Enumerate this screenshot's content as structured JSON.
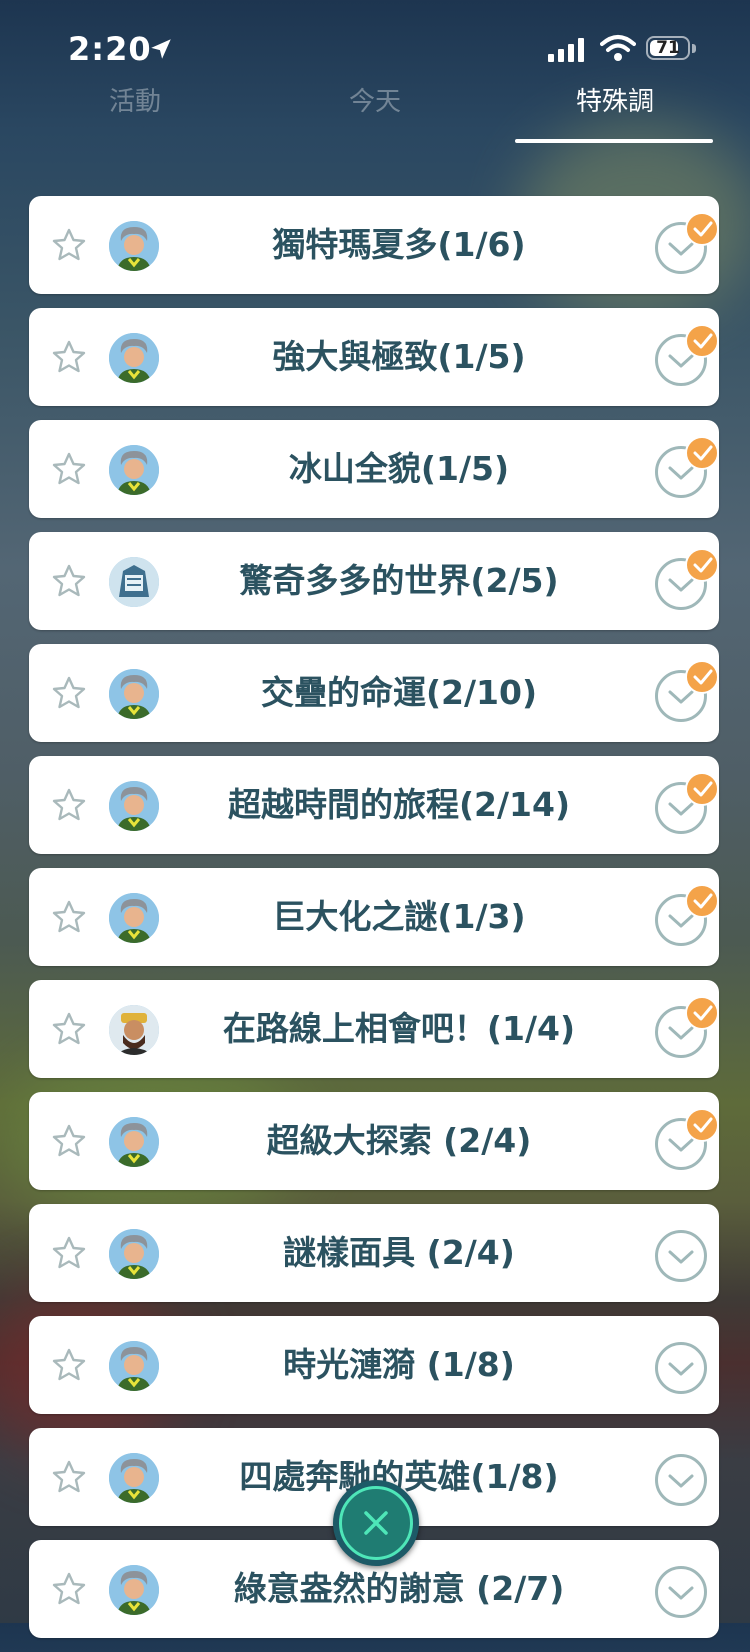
{
  "status_bar": {
    "time": "2:20",
    "battery": "71",
    "battery_level": 0.71
  },
  "tabs": [
    {
      "label": "活動",
      "active": false
    },
    {
      "label": "今天",
      "active": false
    },
    {
      "label": "特殊調",
      "active": true
    }
  ],
  "research_items": [
    {
      "title": "獨特瑪夏多(1/6)",
      "avatar": "professor-willow-avatar",
      "completed_step": true
    },
    {
      "title": "強大與極致(1/5)",
      "avatar": "professor-willow-avatar",
      "completed_step": true
    },
    {
      "title": "冰山全貌(1/5)",
      "avatar": "professor-willow-avatar",
      "completed_step": true
    },
    {
      "title": "驚奇多多的世界(2/5)",
      "avatar": "gift-crest-avatar",
      "completed_step": true
    },
    {
      "title": "交疊的命運(2/10)",
      "avatar": "professor-willow-avatar",
      "completed_step": true
    },
    {
      "title": "超越時間的旅程(2/14)",
      "avatar": "professor-willow-avatar",
      "completed_step": true
    },
    {
      "title": "巨大化之謎(1/3)",
      "avatar": "professor-willow-avatar",
      "completed_step": true
    },
    {
      "title": "在路線上相會吧！(1/4)",
      "avatar": "route-hiker-avatar",
      "completed_step": true
    },
    {
      "title": "超級大探索 (2/4)",
      "avatar": "professor-willow-avatar",
      "completed_step": true
    },
    {
      "title": "謎樣面具 (2/4)",
      "avatar": "professor-willow-avatar",
      "completed_step": false
    },
    {
      "title": "時光漣漪 (1/8)",
      "avatar": "professor-willow-avatar",
      "completed_step": false
    },
    {
      "title": "四處奔馳的英雄(1/8)",
      "avatar": "professor-willow-avatar",
      "completed_step": false
    },
    {
      "title": "綠意盎然的謝意 (2/7)",
      "avatar": "professor-willow-avatar",
      "completed_step": false
    }
  ],
  "colors": {
    "accent_orange": "#f4a349",
    "title_text": "#2b5260",
    "close_ring": "#4ee6b8"
  }
}
